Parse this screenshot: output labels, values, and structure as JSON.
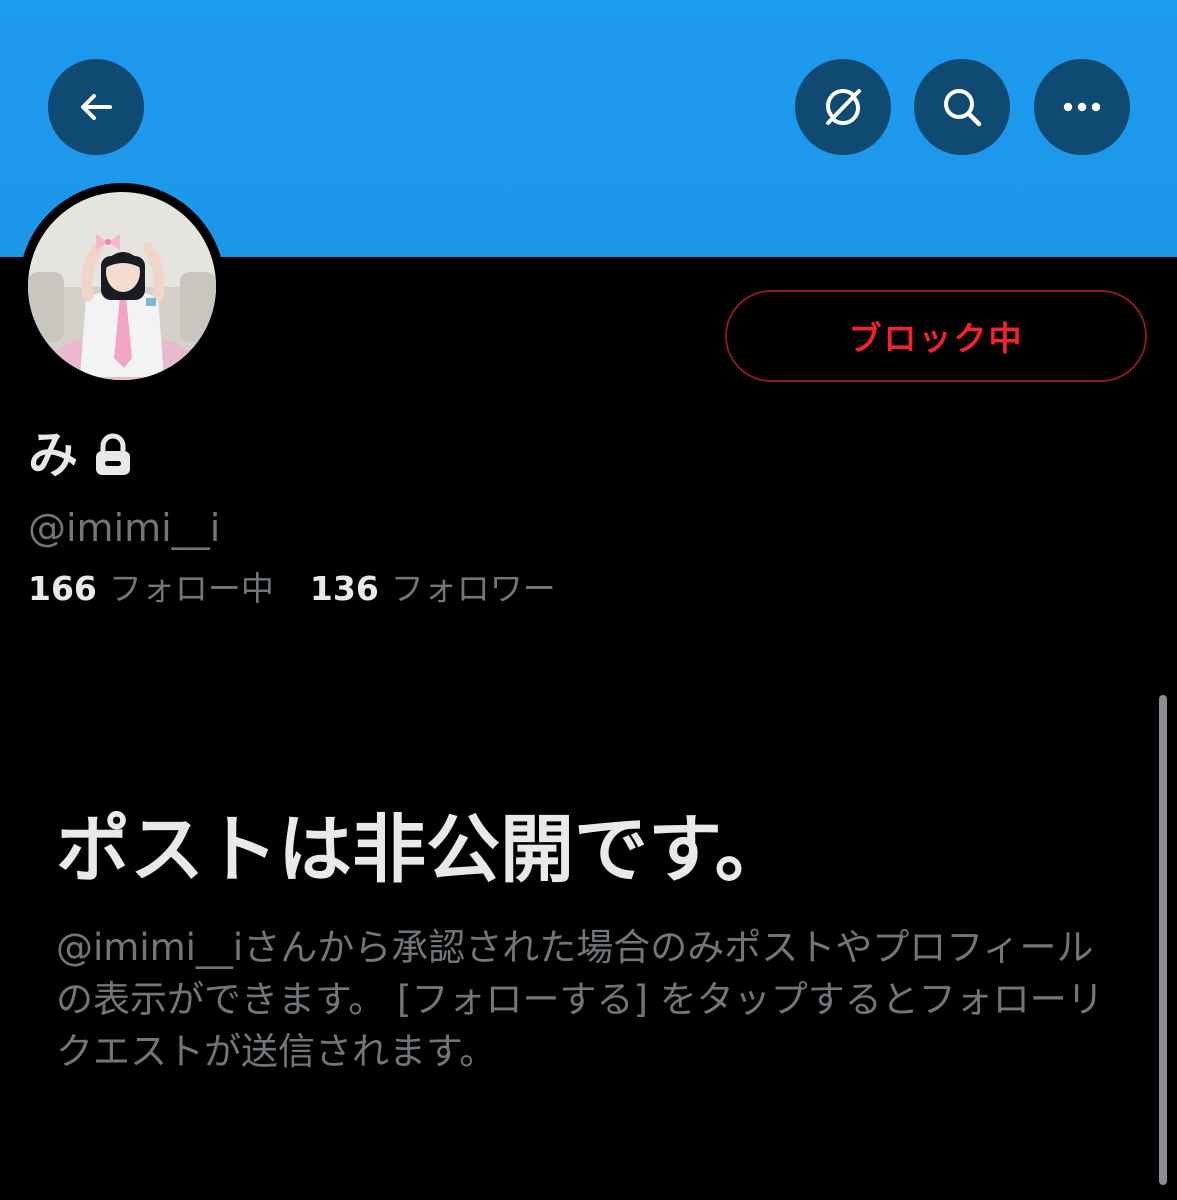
{
  "header": {
    "back_icon": "arrow-left-icon",
    "grok_icon": "grok-icon",
    "search_icon": "search-icon",
    "more_icon": "more-horizontal-icon",
    "banner_color": "#1d9bf0"
  },
  "profile": {
    "display_name": "み",
    "protected_icon": "lock-icon",
    "handle": "@imimi__i",
    "block_button_label": "ブロック中",
    "following_count": "166",
    "following_label": "フォロー中",
    "followers_count": "136",
    "followers_label": "フォロワー"
  },
  "private_notice": {
    "title": "ポストは非公開です。",
    "description": "@imimi__iさんから承認された場合のみポストやプロフィールの表示ができます。 [フォローする] をタップするとフォローリクエストが送信されます。"
  },
  "colors": {
    "accent": "#1d9bf0",
    "block_red": "#f4212e",
    "text_primary": "#e7e9ea",
    "text_secondary": "#71767b",
    "background": "#000000"
  }
}
